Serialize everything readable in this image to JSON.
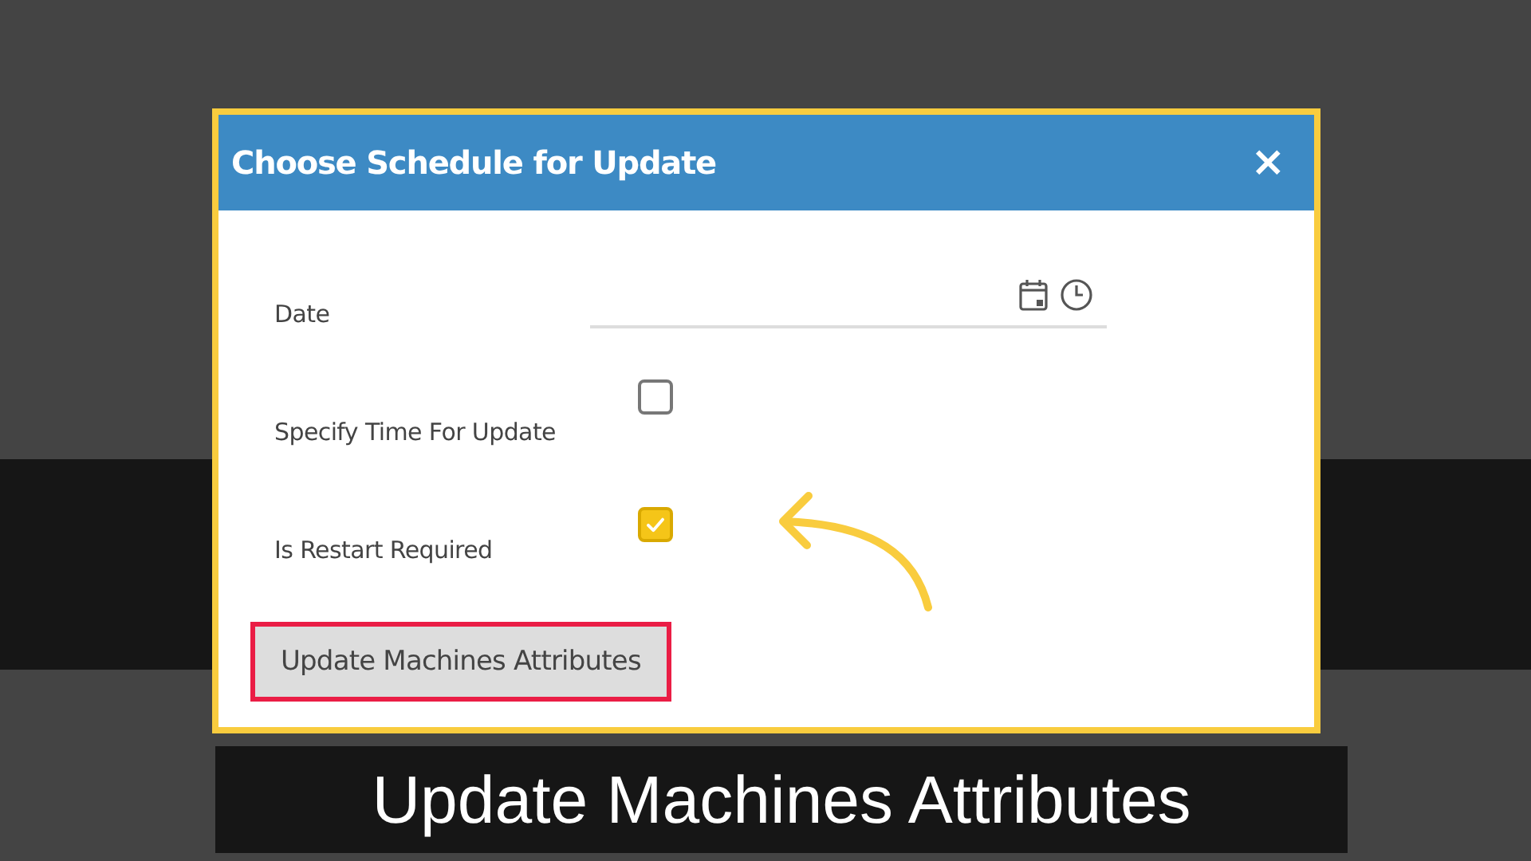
{
  "dialog": {
    "title": "Choose Schedule for Update",
    "close": "×",
    "fields": [
      {
        "kind": "date",
        "label": "Date"
      },
      {
        "kind": "checkbox",
        "label": "Specify Time For Update",
        "checked": false
      },
      {
        "kind": "checkbox",
        "label": "Is Restart Required",
        "checked": true
      }
    ],
    "button": {
      "label": "Update Machines Attributes",
      "highlighted": true
    }
  },
  "caption": "Update Machines Attributes"
}
